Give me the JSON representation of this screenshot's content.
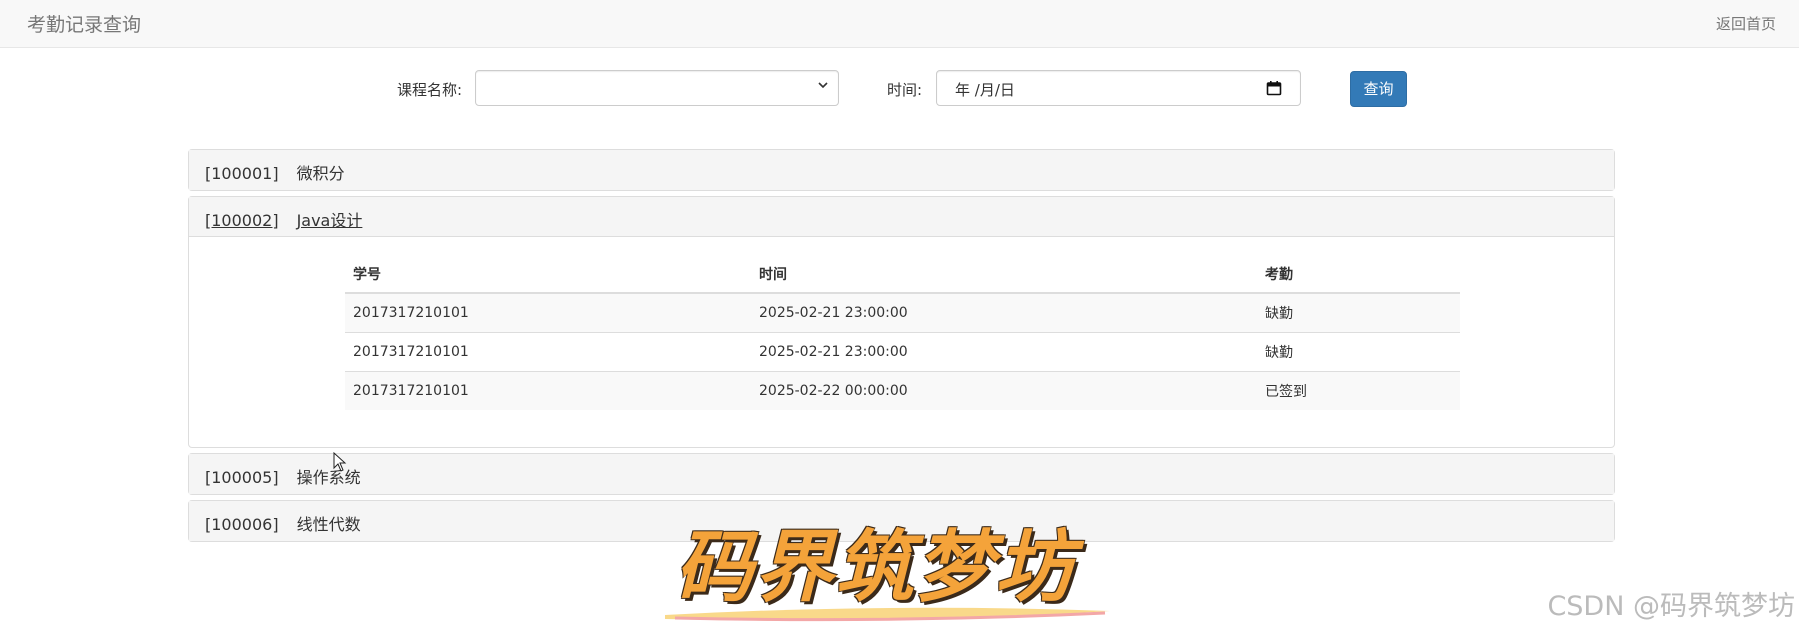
{
  "header": {
    "title": "考勤记录查询",
    "home_link": "返回首页"
  },
  "search": {
    "course_label": "课程名称:",
    "course_value": "",
    "time_label": "时间:",
    "date_placeholder": "年 /月/日",
    "query_button": "查询"
  },
  "courses": [
    {
      "code": "[100001]",
      "name": "微积分",
      "expanded": false
    },
    {
      "code": "[100002]",
      "name": "Java设计",
      "expanded": true
    },
    {
      "code": "[100005]",
      "name": "操作系统",
      "expanded": false
    },
    {
      "code": "[100006]",
      "name": "线性代数",
      "expanded": false
    }
  ],
  "attendance_table": {
    "headers": [
      "学号",
      "时间",
      "考勤"
    ],
    "rows": [
      [
        "2017317210101",
        "2025-02-21 23:00:00",
        "缺勤"
      ],
      [
        "2017317210101",
        "2025-02-21 23:00:00",
        "缺勤"
      ],
      [
        "2017317210101",
        "2025-02-22 00:00:00",
        "已签到"
      ]
    ]
  },
  "watermark": {
    "logo_text": "码界筑梦坊",
    "csdn_text": "CSDN @码界筑梦坊"
  },
  "colors": {
    "primary": "#337ab7",
    "navbar_bg": "#f8f8f8",
    "panel_heading_bg": "#f5f5f5",
    "logo_orange": "#f4a33a"
  },
  "icons": {
    "select_arrow": "chevron-down-icon",
    "date_picker": "calendar-icon",
    "pointer": "mouse-cursor-icon"
  }
}
